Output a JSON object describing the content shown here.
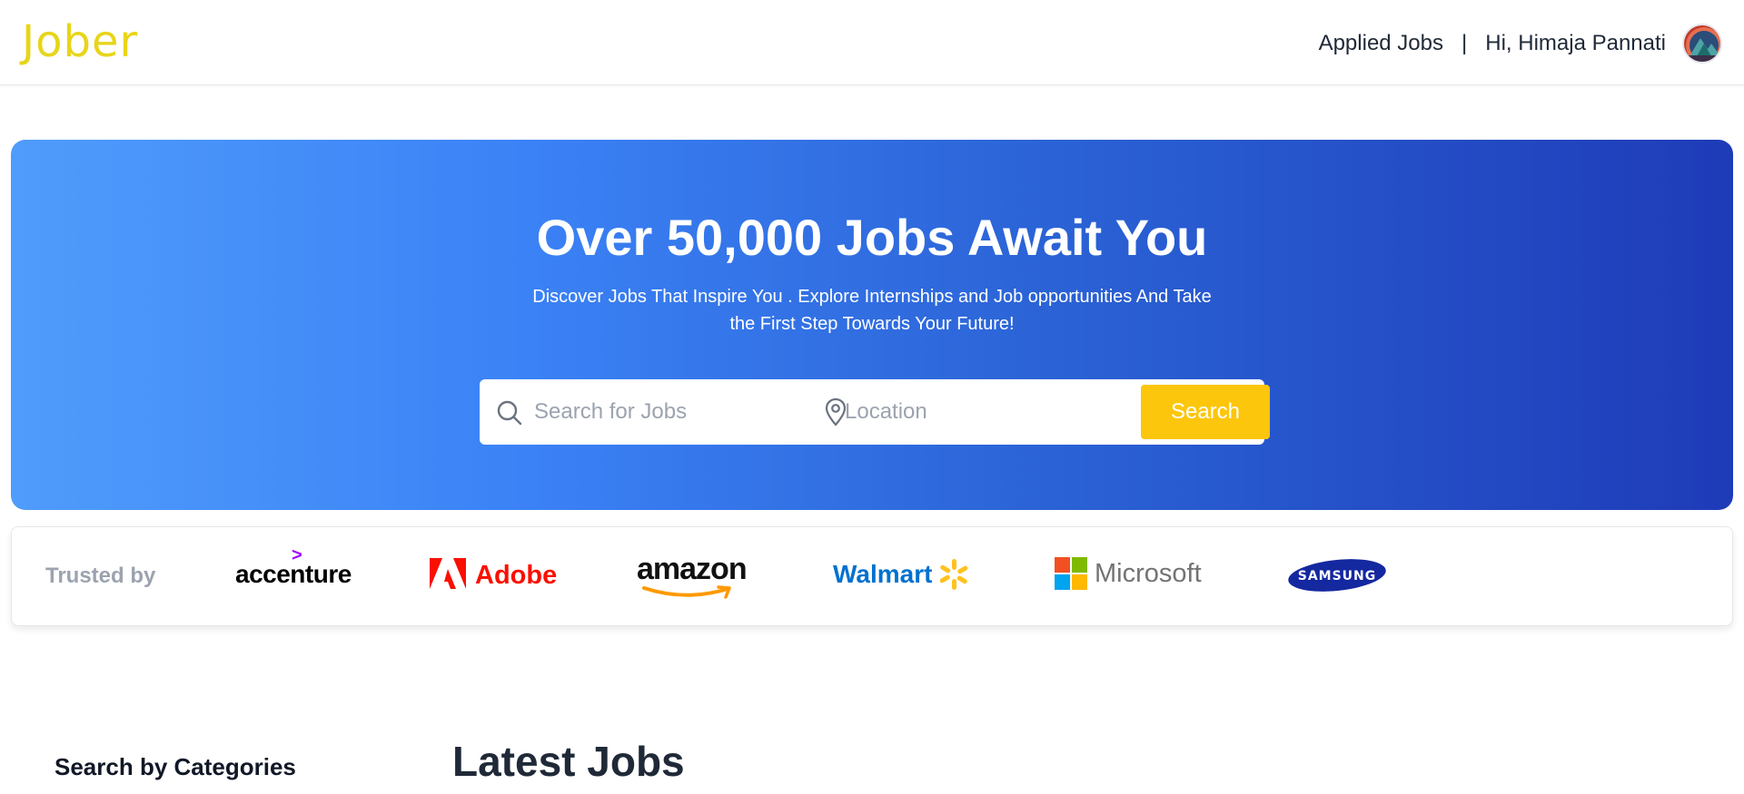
{
  "header": {
    "logo": "Jober",
    "applied_jobs": "Applied Jobs",
    "separator": "|",
    "greeting": "Hi, Himaja Pannati",
    "avatar_icon": "avatar-mountain-icon"
  },
  "hero": {
    "title": "Over 50,000 Jobs Await You",
    "subtitle": "Discover Jobs That Inspire You . Explore Internships and Job opportunities And Take the First Step Towards Your Future!",
    "search": {
      "placeholder": "Search for Jobs",
      "value": "",
      "icon": "search-icon"
    },
    "location": {
      "placeholder": "Location",
      "value": "",
      "icon": "map-pin-icon"
    },
    "search_button": "Search"
  },
  "trusted": {
    "label": "Trusted by",
    "brands": [
      {
        "name": "accenture"
      },
      {
        "name": "Adobe"
      },
      {
        "name": "amazon"
      },
      {
        "name": "Walmart"
      },
      {
        "name": "Microsoft"
      },
      {
        "name": "SAMSUNG"
      }
    ]
  },
  "sections": {
    "categories_title": "Search by Categories",
    "latest_title": "Latest Jobs"
  },
  "colors": {
    "logo": "#e8d51a",
    "hero_gradient_start": "#4f9cfb",
    "hero_gradient_end": "#1e3bb8",
    "search_button": "#fcc60c",
    "text_muted": "#9ca3af"
  }
}
